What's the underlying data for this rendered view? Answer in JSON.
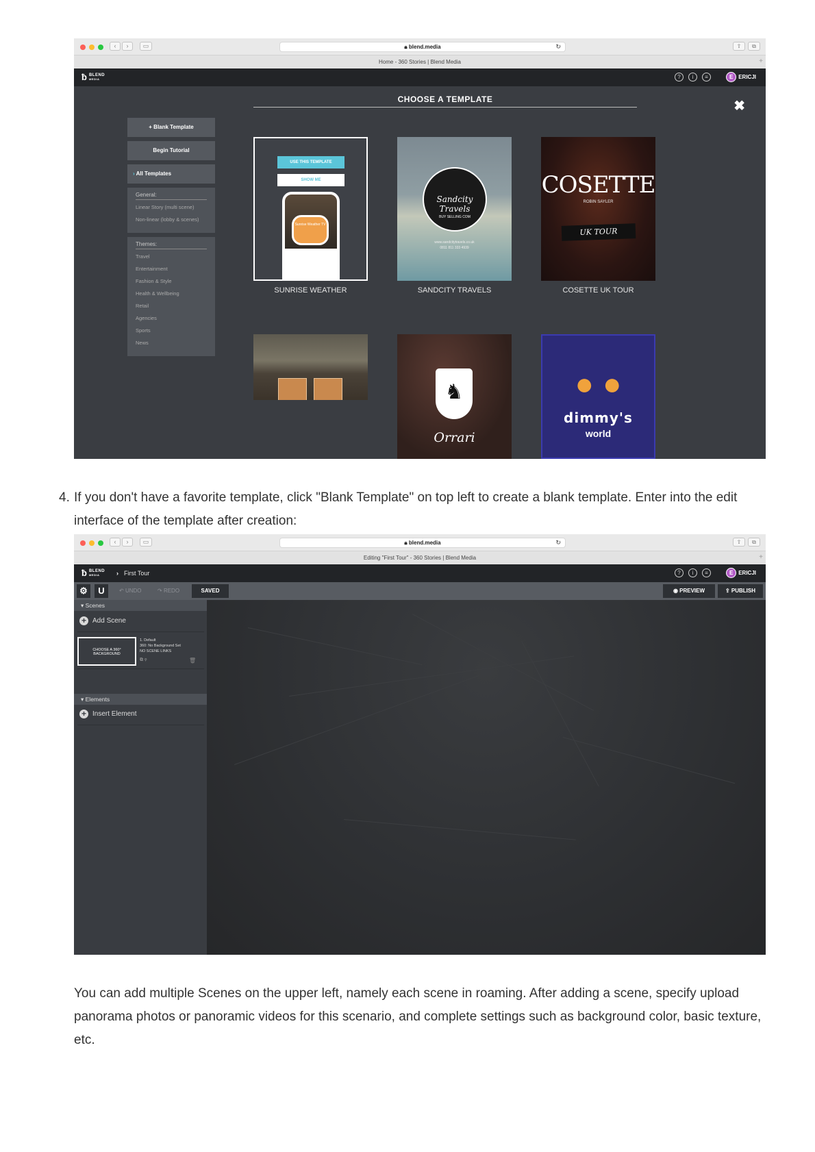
{
  "shot1": {
    "url": "blend.media",
    "page_title": "Home - 360 Stories | Blend Media",
    "logo_text": "BLEND",
    "logo_sub": "MEDIA",
    "user": "ERICJI",
    "avatar_letter": "E",
    "heading": "CHOOSE A TEMPLATE",
    "sidebar": {
      "blank": "+ Blank Template",
      "tutorial": "Begin Tutorial",
      "all": "All Templates",
      "general_head": "General:",
      "general_items": [
        "Linear Story (multi scene)",
        "Non-linear (lobby & scenes)"
      ],
      "themes_head": "Themes:",
      "theme_items": [
        "Travel",
        "Entertainment",
        "Fashion & Style",
        "Health & Wellbeing",
        "Retail",
        "Agencies",
        "Sports",
        "News"
      ]
    },
    "cards": [
      {
        "label": "SUNRISE WEATHER",
        "use": "USE THIS TEMPLATE",
        "show": "SHOW ME",
        "inner": "Sunrise Weather TV"
      },
      {
        "label": "SANDCITY TRAVELS",
        "logo": "Sandcity Travels",
        "sub": "BUY SELLING COM",
        "foot1": "www.sandcitytravels.co.uk",
        "foot2": "0811 811 333 4939"
      },
      {
        "label": "COSETTE UK TOUR",
        "logo": "COSETTE",
        "sub": "ROBIN SAYLER",
        "tour": "UK TOUR"
      },
      {
        "label": ""
      },
      {
        "label": "",
        "logo": "Orrari"
      },
      {
        "label": "",
        "logo": "dimmy's",
        "sub": "world"
      }
    ]
  },
  "step4": {
    "number": "4.",
    "text": "If you don't have a favorite template, click \"Blank Template\" on top left to create a blank template. Enter into the edit interface of the template after creation:"
  },
  "shot2": {
    "url": "blend.media",
    "page_title": "Editing \"First Tour\" - 360 Stories | Blend Media",
    "logo_text": "BLEND",
    "logo_sub": "MEDIA",
    "breadcrumb": "First Tour",
    "user": "ERICJI",
    "avatar_letter": "E",
    "undo": "UNDO",
    "redo": "REDO",
    "saved": "SAVED",
    "preview": "PREVIEW",
    "publish": "PUBLISH",
    "scenes_head": "Scenes",
    "add_scene": "Add Scene",
    "scene_thumb": "CHOOSE A 360° BACKGROUND",
    "scene_line1": "1. Default",
    "scene_line2": "360: No Background Set",
    "scene_line3": "NO SCENE LINKS",
    "elements_head": "Elements",
    "insert_element": "Insert Element"
  },
  "paragraph": "You can add multiple Scenes on the upper left, namely each scene in roaming. After adding a scene, specify upload panorama photos or panoramic videos for this scenario, and complete settings such as background color, basic texture, etc."
}
